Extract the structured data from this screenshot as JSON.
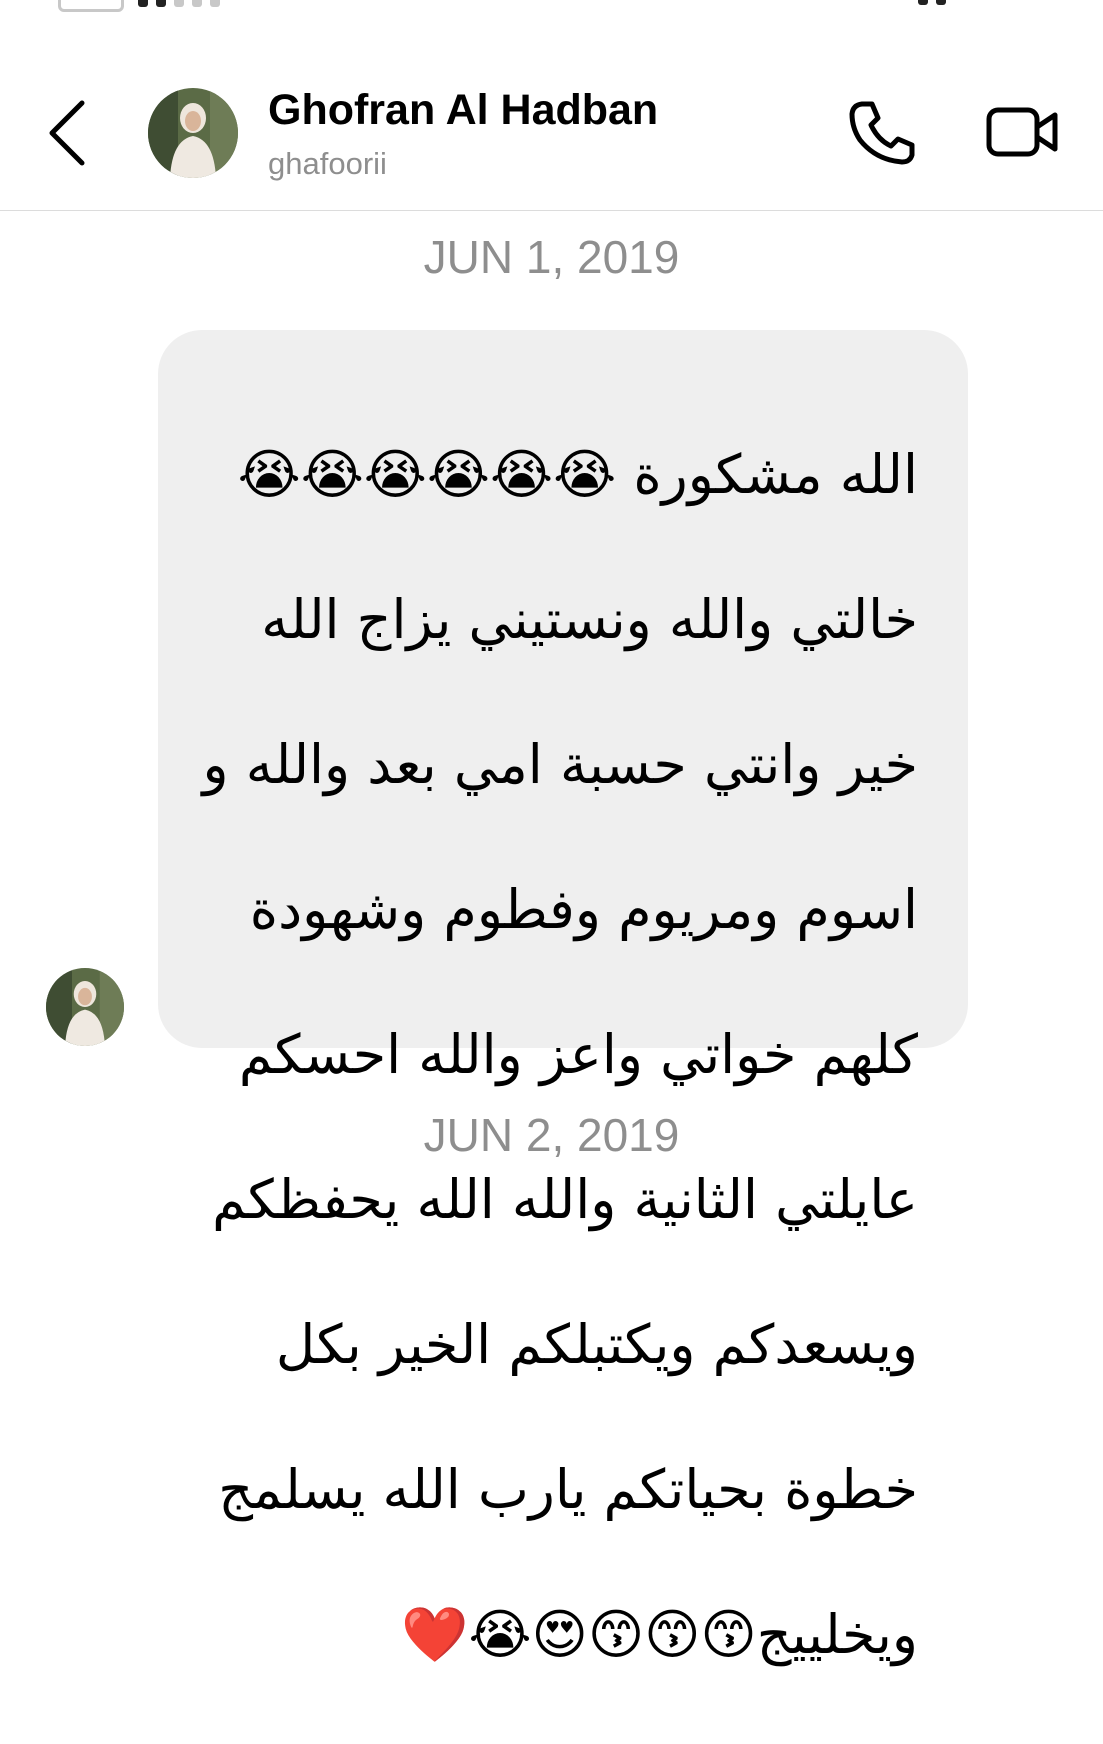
{
  "contact": {
    "name": "Ghofran Al Hadban",
    "username": "ghafoorii"
  },
  "icons": {
    "back": "chevron-left-icon",
    "call": "phone-icon",
    "video": "video-camera-icon"
  },
  "dates": {
    "first": "JUN 1, 2019",
    "second": "JUN 2, 2019"
  },
  "message": {
    "lines": [
      "الله مشكورة 😭😭😭😭😭😭",
      "خالتي والله ونستيني يزاج الله",
      "خير وانتي حسبة امي بعد والله و",
      "اسوم ومريوم وفطوم وشهودة",
      "كلهم خواتي واعز والله احسكم",
      "عايلتي الثانية والله الله يحفظكم",
      "ويسعدكم ويكتبلكم الخير بكل",
      "خطوة بحياتكم يارب الله يسلمج",
      "ويخلييج😙😙😙😍😭❤️"
    ]
  },
  "colors": {
    "bubble_bg": "#efefef",
    "secondary_text": "#8e8e8e",
    "divider": "#dcdcdc"
  }
}
